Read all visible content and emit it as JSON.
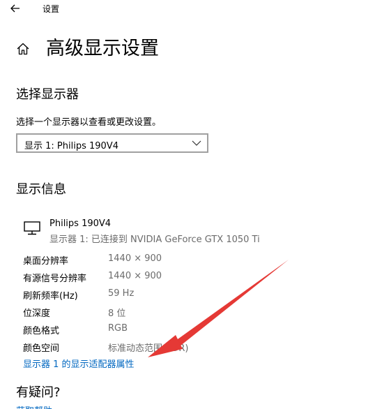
{
  "window": {
    "title": "设置",
    "back_icon": "arrow-left-icon"
  },
  "header": {
    "home_icon": "home-icon",
    "title": "高级显示设置"
  },
  "select_display": {
    "heading": "选择显示器",
    "description": "选择一个显示器以查看或更改设置。",
    "selected_value": "显示 1: Philips 190V4"
  },
  "display_info": {
    "heading": "显示信息",
    "monitor_name": "Philips 190V4",
    "monitor_subtitle": "显示器 1: 已连接到 NVIDIA GeForce GTX 1050 Ti",
    "rows": [
      {
        "label": "桌面分辨率",
        "value": "1440 × 900"
      },
      {
        "label": "有源信号分辨率",
        "value": "1440 × 900"
      },
      {
        "label": "刷新频率(Hz)",
        "value": "59 Hz"
      },
      {
        "label": "位深度",
        "value": "8 位"
      },
      {
        "label": "颜色格式",
        "value": "RGB"
      },
      {
        "label": "颜色空间",
        "value": "标准动态范围(SDR)"
      }
    ],
    "adapter_link": "显示器 1 的显示适配器属性"
  },
  "help": {
    "heading": "有疑问?",
    "link": "获取帮助"
  },
  "colors": {
    "link": "#0067c0",
    "secondary_text": "#6b6b6b",
    "annotation_arrow": "#e53935"
  }
}
